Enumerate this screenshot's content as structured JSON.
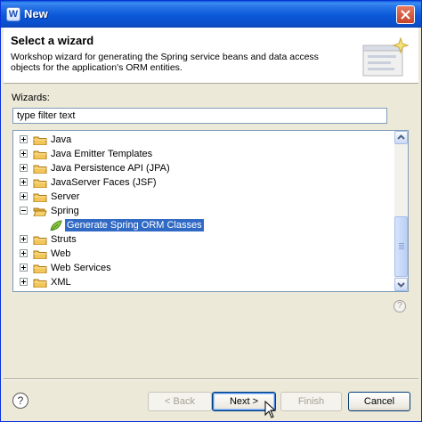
{
  "window": {
    "title": "New",
    "app_icon": "W"
  },
  "header": {
    "title": "Select a wizard",
    "description": "Workshop wizard for generating the Spring service beans and data access objects for the application's ORM entities."
  },
  "wizards_label": "Wizards:",
  "filter": {
    "value": "type filter text"
  },
  "tree": {
    "items": [
      {
        "label": "Java",
        "icon": "folder-icon",
        "expander": "plus"
      },
      {
        "label": "Java Emitter Templates",
        "icon": "folder-icon",
        "expander": "plus"
      },
      {
        "label": "Java Persistence API (JPA)",
        "icon": "folder-icon",
        "expander": "plus"
      },
      {
        "label": "JavaServer Faces (JSF)",
        "icon": "folder-icon",
        "expander": "plus"
      },
      {
        "label": "Server",
        "icon": "folder-icon",
        "expander": "plus"
      },
      {
        "label": "Spring",
        "icon": "open-folder-icon",
        "expander": "minus"
      },
      {
        "label": "Generate Spring ORM Classes",
        "icon": "spring-leaf-icon",
        "expander": "none",
        "selected": true
      },
      {
        "label": "Struts",
        "icon": "folder-icon",
        "expander": "plus"
      },
      {
        "label": "Web",
        "icon": "folder-icon",
        "expander": "plus"
      },
      {
        "label": "Web Services",
        "icon": "folder-icon",
        "expander": "plus"
      },
      {
        "label": "XML",
        "icon": "folder-icon",
        "expander": "plus"
      }
    ]
  },
  "buttons": {
    "help": "?",
    "back": "< Back",
    "next": "Next >",
    "finish": "Finish",
    "cancel": "Cancel"
  },
  "colors": {
    "selection": "#316ac5",
    "titlebar": "#0b58d8",
    "folder": "#f3c65a"
  }
}
